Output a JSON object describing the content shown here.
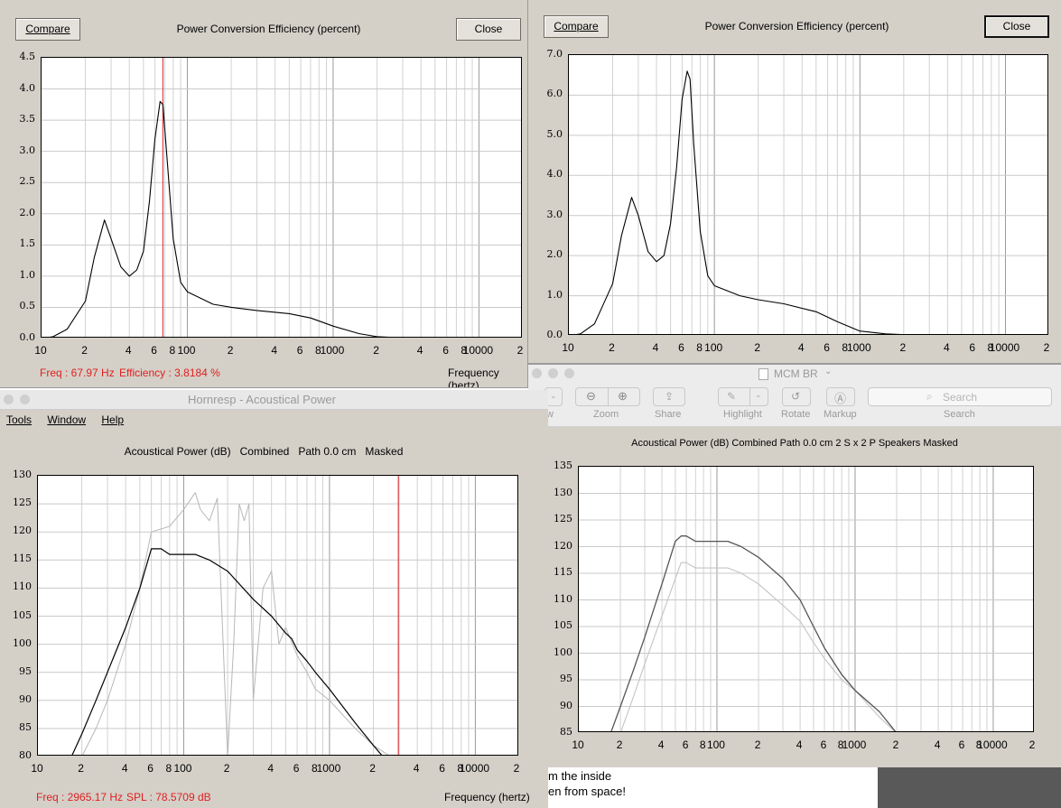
{
  "win1": {
    "compare_label": "Compare",
    "close_label": "Close",
    "title": "Power Conversion Efficiency (percent)",
    "y_ticks": [
      "4.5",
      "4.0",
      "3.5",
      "3.0",
      "2.5",
      "2.0",
      "1.5",
      "1.0",
      "0.5",
      "0.0"
    ],
    "x_ticks": [
      "10",
      "2",
      "4",
      "6",
      "8",
      "100",
      "2",
      "4",
      "6",
      "8",
      "1000",
      "2",
      "4",
      "6",
      "8",
      "10000",
      "2"
    ],
    "status_freq": "Freq : 67.97 Hz",
    "status_eff": "Efficiency : 3.8184 %",
    "x_axis_label": "Frequency (hertz)"
  },
  "win2": {
    "compare_label": "Compare",
    "close_label": "Close",
    "title": "Power Conversion Efficiency (percent)",
    "y_ticks": [
      "7.0",
      "6.0",
      "5.0",
      "4.0",
      "3.0",
      "2.0",
      "1.0",
      "0.0"
    ],
    "x_ticks": [
      "10",
      "2",
      "4",
      "6",
      "8",
      "100",
      "2",
      "4",
      "6",
      "8",
      "1000",
      "2",
      "4",
      "6",
      "8",
      "10000",
      "2"
    ]
  },
  "win3": {
    "window_title": "Hornresp - Acoustical Power",
    "menu": [
      "Tools",
      "Window",
      "Help"
    ],
    "title": "Acoustical Power (dB)   Combined   Path 0.0 cm   Masked",
    "y_ticks": [
      "130",
      "125",
      "120",
      "115",
      "110",
      "105",
      "100",
      "95",
      "90",
      "85",
      "80"
    ],
    "x_ticks": [
      "10",
      "2",
      "4",
      "6",
      "8",
      "100",
      "2",
      "4",
      "6",
      "8",
      "1000",
      "2",
      "4",
      "6",
      "8",
      "10000",
      "2"
    ],
    "status_freq": "Freq : 2965.17 Hz",
    "status_spl": "SPL : 78.5709 dB",
    "x_axis_label": "Frequency (hertz)"
  },
  "preview": {
    "window_title": "MCM BR",
    "toolbar": {
      "view_label": "w",
      "zoom_label": "Zoom",
      "share_label": "Share",
      "highlight_label": "Highlight",
      "rotate_label": "Rotate",
      "markup_label": "Markup",
      "search_label": "Search",
      "search_placeholder": "Search"
    },
    "title": "Acoustical Power (dB)   Combined   Path 0.0 cm   2 S x 2 P Speakers   Masked",
    "y_ticks": [
      "135",
      "130",
      "125",
      "120",
      "115",
      "110",
      "105",
      "100",
      "95",
      "90",
      "85"
    ],
    "x_ticks": [
      "10",
      "2",
      "4",
      "6",
      "8",
      "100",
      "2",
      "4",
      "6",
      "8",
      "1000",
      "2",
      "4",
      "6",
      "8",
      "10000",
      "2"
    ]
  },
  "bg_text": {
    "line1": "m the inside",
    "line2": "en from space!"
  },
  "chart_data": [
    {
      "type": "line",
      "title": "Power Conversion Efficiency (percent)",
      "xlabel": "Frequency (hertz)",
      "x_scale": "log",
      "xlim": [
        10,
        20000
      ],
      "ylim": [
        0,
        4.5
      ],
      "grid": true,
      "cursor_x": 67.97,
      "series": [
        {
          "x": [
            10,
            12,
            15,
            20,
            23,
            27,
            30,
            35,
            40,
            45,
            50,
            55,
            60,
            65,
            68,
            72,
            80,
            90,
            100,
            150,
            200,
            300,
            500,
            700,
            1000,
            1500,
            2000,
            3000,
            4000,
            4500
          ],
          "y": [
            0.0,
            0.03,
            0.15,
            0.6,
            1.3,
            1.9,
            1.6,
            1.15,
            1.0,
            1.1,
            1.4,
            2.2,
            3.2,
            3.8,
            3.75,
            3.0,
            1.6,
            0.9,
            0.75,
            0.55,
            0.5,
            0.45,
            0.4,
            0.33,
            0.2,
            0.08,
            0.03,
            0.01,
            0.0,
            0.0
          ]
        }
      ]
    },
    {
      "type": "line",
      "title": "Power Conversion Efficiency (percent)",
      "x_scale": "log",
      "xlim": [
        10,
        20000
      ],
      "ylim": [
        0,
        7.0
      ],
      "grid": true,
      "series": [
        {
          "x": [
            10,
            12,
            15,
            20,
            23,
            27,
            30,
            35,
            40,
            45,
            50,
            55,
            60,
            65,
            68,
            72,
            80,
            90,
            100,
            150,
            200,
            300,
            500,
            700,
            1000,
            1500,
            2000,
            3000,
            4000
          ],
          "y": [
            0.0,
            0.05,
            0.3,
            1.3,
            2.5,
            3.45,
            3.0,
            2.1,
            1.85,
            2.0,
            2.8,
            4.2,
            5.9,
            6.6,
            6.4,
            4.8,
            2.6,
            1.5,
            1.25,
            1.0,
            0.9,
            0.8,
            0.6,
            0.35,
            0.12,
            0.05,
            0.03,
            0.01,
            0.0
          ]
        }
      ]
    },
    {
      "type": "line",
      "title": "Acoustical Power (dB)   Combined   Path 0.0 cm   Masked",
      "xlabel": "Frequency (hertz)",
      "x_scale": "log",
      "xlim": [
        10,
        20000
      ],
      "ylim": [
        80,
        130
      ],
      "grid": true,
      "cursor_x": 2965.17,
      "series": [
        {
          "x": [
            17,
            20,
            25,
            30,
            40,
            50,
            60,
            70,
            80,
            100,
            120,
            150,
            200,
            300,
            400,
            500,
            550,
            600,
            700,
            800,
            1000,
            1500,
            2000,
            2500,
            3000
          ],
          "y": [
            80,
            84,
            90,
            95,
            103,
            110,
            117,
            117,
            116,
            116,
            116,
            115,
            113,
            108,
            105,
            102,
            101,
            99,
            97,
            95,
            92,
            86,
            82,
            79,
            78
          ]
        },
        {
          "x": [
            20,
            25,
            30,
            40,
            50,
            60,
            80,
            100,
            120,
            130,
            150,
            170,
            200,
            220,
            240,
            260,
            280,
            300,
            350,
            400,
            450,
            500,
            600,
            700,
            800,
            1000,
            1500,
            2000,
            3000,
            3500
          ],
          "y": [
            80,
            85,
            90,
            100,
            110,
            120,
            121,
            124,
            127,
            124,
            122,
            126,
            80,
            100,
            125,
            122,
            125,
            90,
            110,
            113,
            100,
            103,
            98,
            95,
            92,
            90,
            85,
            82,
            79,
            78
          ]
        }
      ]
    },
    {
      "type": "line",
      "title": "Acoustical Power (dB)   Combined   Path 0.0 cm   2 S x 2 P Speakers   Masked",
      "x_scale": "log",
      "xlim": [
        10,
        20000
      ],
      "ylim": [
        85,
        135
      ],
      "grid": true,
      "series": [
        {
          "x": [
            17,
            20,
            25,
            30,
            40,
            50,
            55,
            60,
            70,
            80,
            100,
            120,
            150,
            200,
            300,
            400,
            500,
            600,
            800,
            1000,
            1500,
            2000
          ],
          "y": [
            85,
            90,
            97,
            103,
            113,
            121,
            122,
            122,
            121,
            121,
            121,
            121,
            120,
            118,
            114,
            110,
            105,
            101,
            96,
            93,
            89,
            85
          ]
        },
        {
          "x": [
            20,
            25,
            30,
            40,
            50,
            55,
            60,
            70,
            80,
            100,
            120,
            150,
            200,
            300,
            400,
            500,
            600,
            800,
            1000,
            1500,
            2000
          ],
          "y": [
            85,
            92,
            98,
            107,
            114,
            117,
            117,
            116,
            116,
            116,
            116,
            115,
            113,
            109,
            106,
            102,
            99,
            95,
            93,
            88,
            85
          ]
        }
      ]
    }
  ]
}
